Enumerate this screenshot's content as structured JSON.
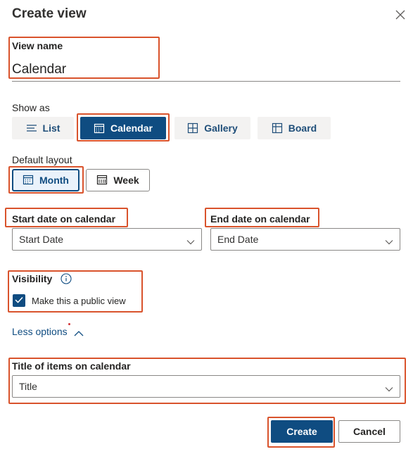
{
  "dialog": {
    "title": "Create view",
    "close_icon": "close-icon"
  },
  "view_name": {
    "label": "View name",
    "value": "Calendar"
  },
  "show_as": {
    "label": "Show as",
    "options": [
      {
        "label": "List",
        "icon": "list-icon",
        "selected": false
      },
      {
        "label": "Calendar",
        "icon": "calendar-icon",
        "selected": true
      },
      {
        "label": "Gallery",
        "icon": "gallery-icon",
        "selected": false
      },
      {
        "label": "Board",
        "icon": "board-icon",
        "selected": false
      }
    ]
  },
  "default_layout": {
    "label": "Default layout",
    "options": [
      {
        "label": "Month",
        "icon": "calendar-icon",
        "selected": true
      },
      {
        "label": "Week",
        "icon": "calendar-icon",
        "selected": false
      }
    ]
  },
  "start_date": {
    "label": "Start date on calendar",
    "value": "Start Date"
  },
  "end_date": {
    "label": "End date on calendar",
    "value": "End Date"
  },
  "visibility": {
    "label": "Visibility",
    "checkbox_label": "Make this a public view",
    "checked": true
  },
  "options_toggle": {
    "label": "Less options"
  },
  "title_field": {
    "label": "Title of items on calendar",
    "value": "Title"
  },
  "footer": {
    "create_label": "Create",
    "cancel_label": "Cancel"
  },
  "colors": {
    "primary": "#0f4c81",
    "highlight": "#d9532c",
    "segment_bg": "#f3f2f1"
  }
}
